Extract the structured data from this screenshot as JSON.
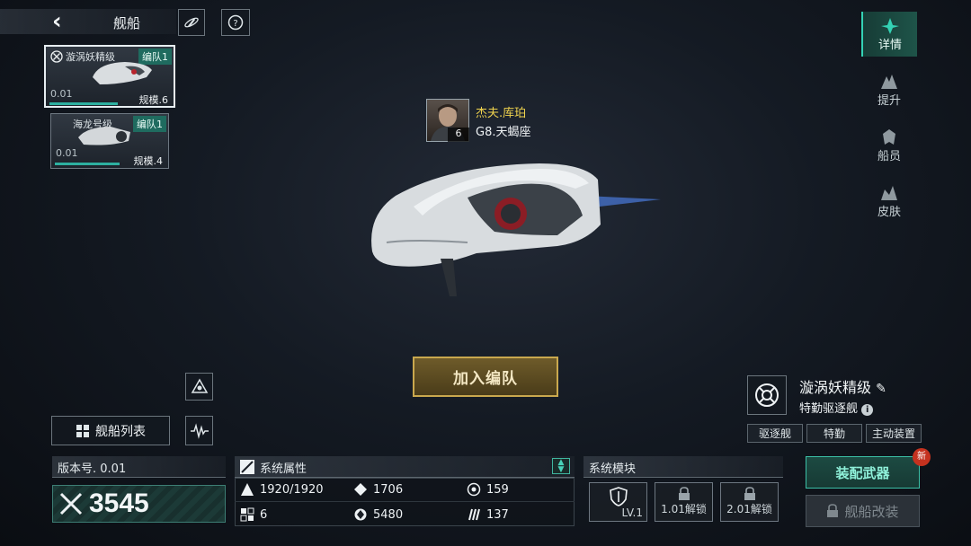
{
  "header": {
    "title": "舰船"
  },
  "fleet_cards": [
    {
      "name": "漩涡妖精级",
      "badge": "编队1",
      "version": "0.01",
      "scale": "规模.6",
      "progress": 0.55
    },
    {
      "name": "海龙号级",
      "badge": "编队1",
      "version": "0.01",
      "scale": "规模.4",
      "progress": 0.55
    }
  ],
  "right_tabs": [
    {
      "label": "详情",
      "icon": "detail-icon",
      "active": true
    },
    {
      "label": "提升",
      "icon": "upgrade-icon",
      "active": false
    },
    {
      "label": "船员",
      "icon": "crew-icon",
      "active": false
    },
    {
      "label": "皮肤",
      "icon": "skin-icon",
      "active": false
    }
  ],
  "captain": {
    "name": "杰夫.库珀",
    "rank": "G8.天蝎座",
    "level": "6"
  },
  "join_button": "加入编队",
  "ship_list_button": "舰船列表",
  "version_label": "版本号. 0.01",
  "power": "3545",
  "attributes": {
    "title": "系统属性",
    "items": [
      {
        "icon": "hull-icon",
        "value": "1920/1920"
      },
      {
        "icon": "armor-icon",
        "value": "1706"
      },
      {
        "icon": "shield-icon",
        "value": "159"
      },
      {
        "icon": "grid-icon",
        "value": "6"
      },
      {
        "icon": "target-icon",
        "value": "5480"
      },
      {
        "icon": "speed-icon",
        "value": "137"
      }
    ]
  },
  "modules": {
    "title": "系统模块",
    "slots": [
      {
        "label": "LV.1"
      },
      {
        "label": "1.01解锁"
      },
      {
        "label": "2.01解锁"
      }
    ]
  },
  "ship": {
    "name": "漩涡妖精级",
    "type": "特勤驱逐舰",
    "tags": [
      "驱逐舰",
      "特勤",
      "主动装置"
    ]
  },
  "equip_button": "装配武器",
  "new_badge": "新",
  "refit_button": "舰船改装",
  "colors": {
    "accent": "#34d2b4",
    "gold": "#c9a84e",
    "captain_name": "#f0d34e"
  }
}
